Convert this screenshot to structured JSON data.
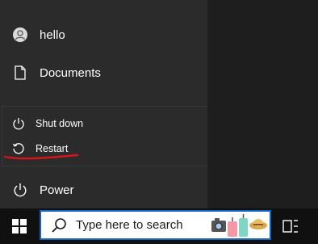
{
  "start_menu": {
    "user": {
      "label": "hello",
      "icon": "user-avatar-icon"
    },
    "documents": {
      "label": "Documents",
      "icon": "document-icon"
    },
    "power": {
      "label": "Power",
      "icon": "power-icon"
    }
  },
  "power_flyout": {
    "items": [
      {
        "label": "Shut down",
        "icon": "power-icon"
      },
      {
        "label": "Restart",
        "icon": "restart-icon"
      }
    ]
  },
  "annotation": {
    "color": "#d8141b"
  },
  "taskbar": {
    "search_placeholder": "Type here to search",
    "search_border_color": "#0b66c8"
  }
}
